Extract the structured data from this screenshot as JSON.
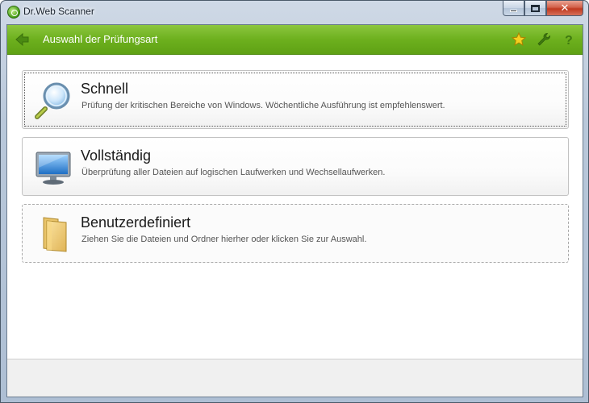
{
  "window": {
    "title": "Dr.Web Scanner",
    "caption_buttons": {
      "minimize": "",
      "maximize": "",
      "close": "✕"
    }
  },
  "header": {
    "title": "Auswahl der Prüfungsart",
    "icons": [
      "back-arrow-icon",
      "star-icon",
      "wrench-icon",
      "help-icon"
    ],
    "help_label": "?",
    "accent_color": "#6db01e"
  },
  "scan_options": [
    {
      "title": "Schnell",
      "description": "Prüfung der kritischen Bereiche von Windows. Wöchentliche Ausführung ist empfehlenswert.",
      "icon": "magnifier-icon"
    },
    {
      "title": "Vollständig",
      "description": "Überprüfung aller Dateien auf logischen Laufwerken und Wechsellaufwerken.",
      "icon": "monitor-icon"
    },
    {
      "title": "Benutzerdefiniert",
      "description": "Ziehen Sie die Dateien und Ordner hierher oder klicken Sie zur Auswahl.",
      "icon": "folder-icon"
    }
  ]
}
